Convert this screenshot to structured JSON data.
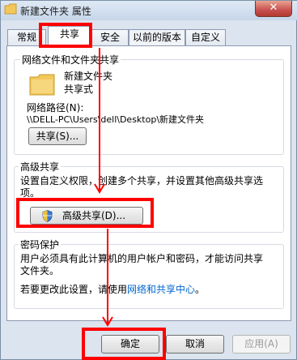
{
  "window": {
    "title": "新建文件夹 属性",
    "close_label": "✕"
  },
  "tabs": [
    {
      "label": "常规"
    },
    {
      "label": "共享"
    },
    {
      "label": "安全"
    },
    {
      "label": "以前的版本"
    },
    {
      "label": "自定义"
    }
  ],
  "network_sharing": {
    "group_title": "网络文件和文件夹共享",
    "folder_name": "新建文件夹",
    "folder_status": "共享式",
    "path_label": "网络路径(N):",
    "path_value": "\\\\DELL-PC\\Users\\dell\\Desktop\\新建文件夹",
    "share_button": "共享(S)..."
  },
  "advanced_sharing": {
    "group_title": "高级共享",
    "description_line1": "设置自定义权限，创建多个共享，并设置其他高级共享选",
    "description_line2": "项。",
    "button": "高级共享(D)..."
  },
  "password_protection": {
    "group_title": "密码保护",
    "text_line1": "用户必须具有此计算机的用户帐户和密码，才能访问共享",
    "text_line2": "文件夹。",
    "change_prefix": "若要更改此设置，请使用",
    "change_link": "网络和共享中心",
    "change_suffix": "。"
  },
  "footer": {
    "ok": "确定",
    "cancel": "取消",
    "apply": "应用(A)"
  },
  "colors": {
    "highlight": "#ff0000",
    "link": "#0066cc",
    "folder": "#f2c75c"
  }
}
